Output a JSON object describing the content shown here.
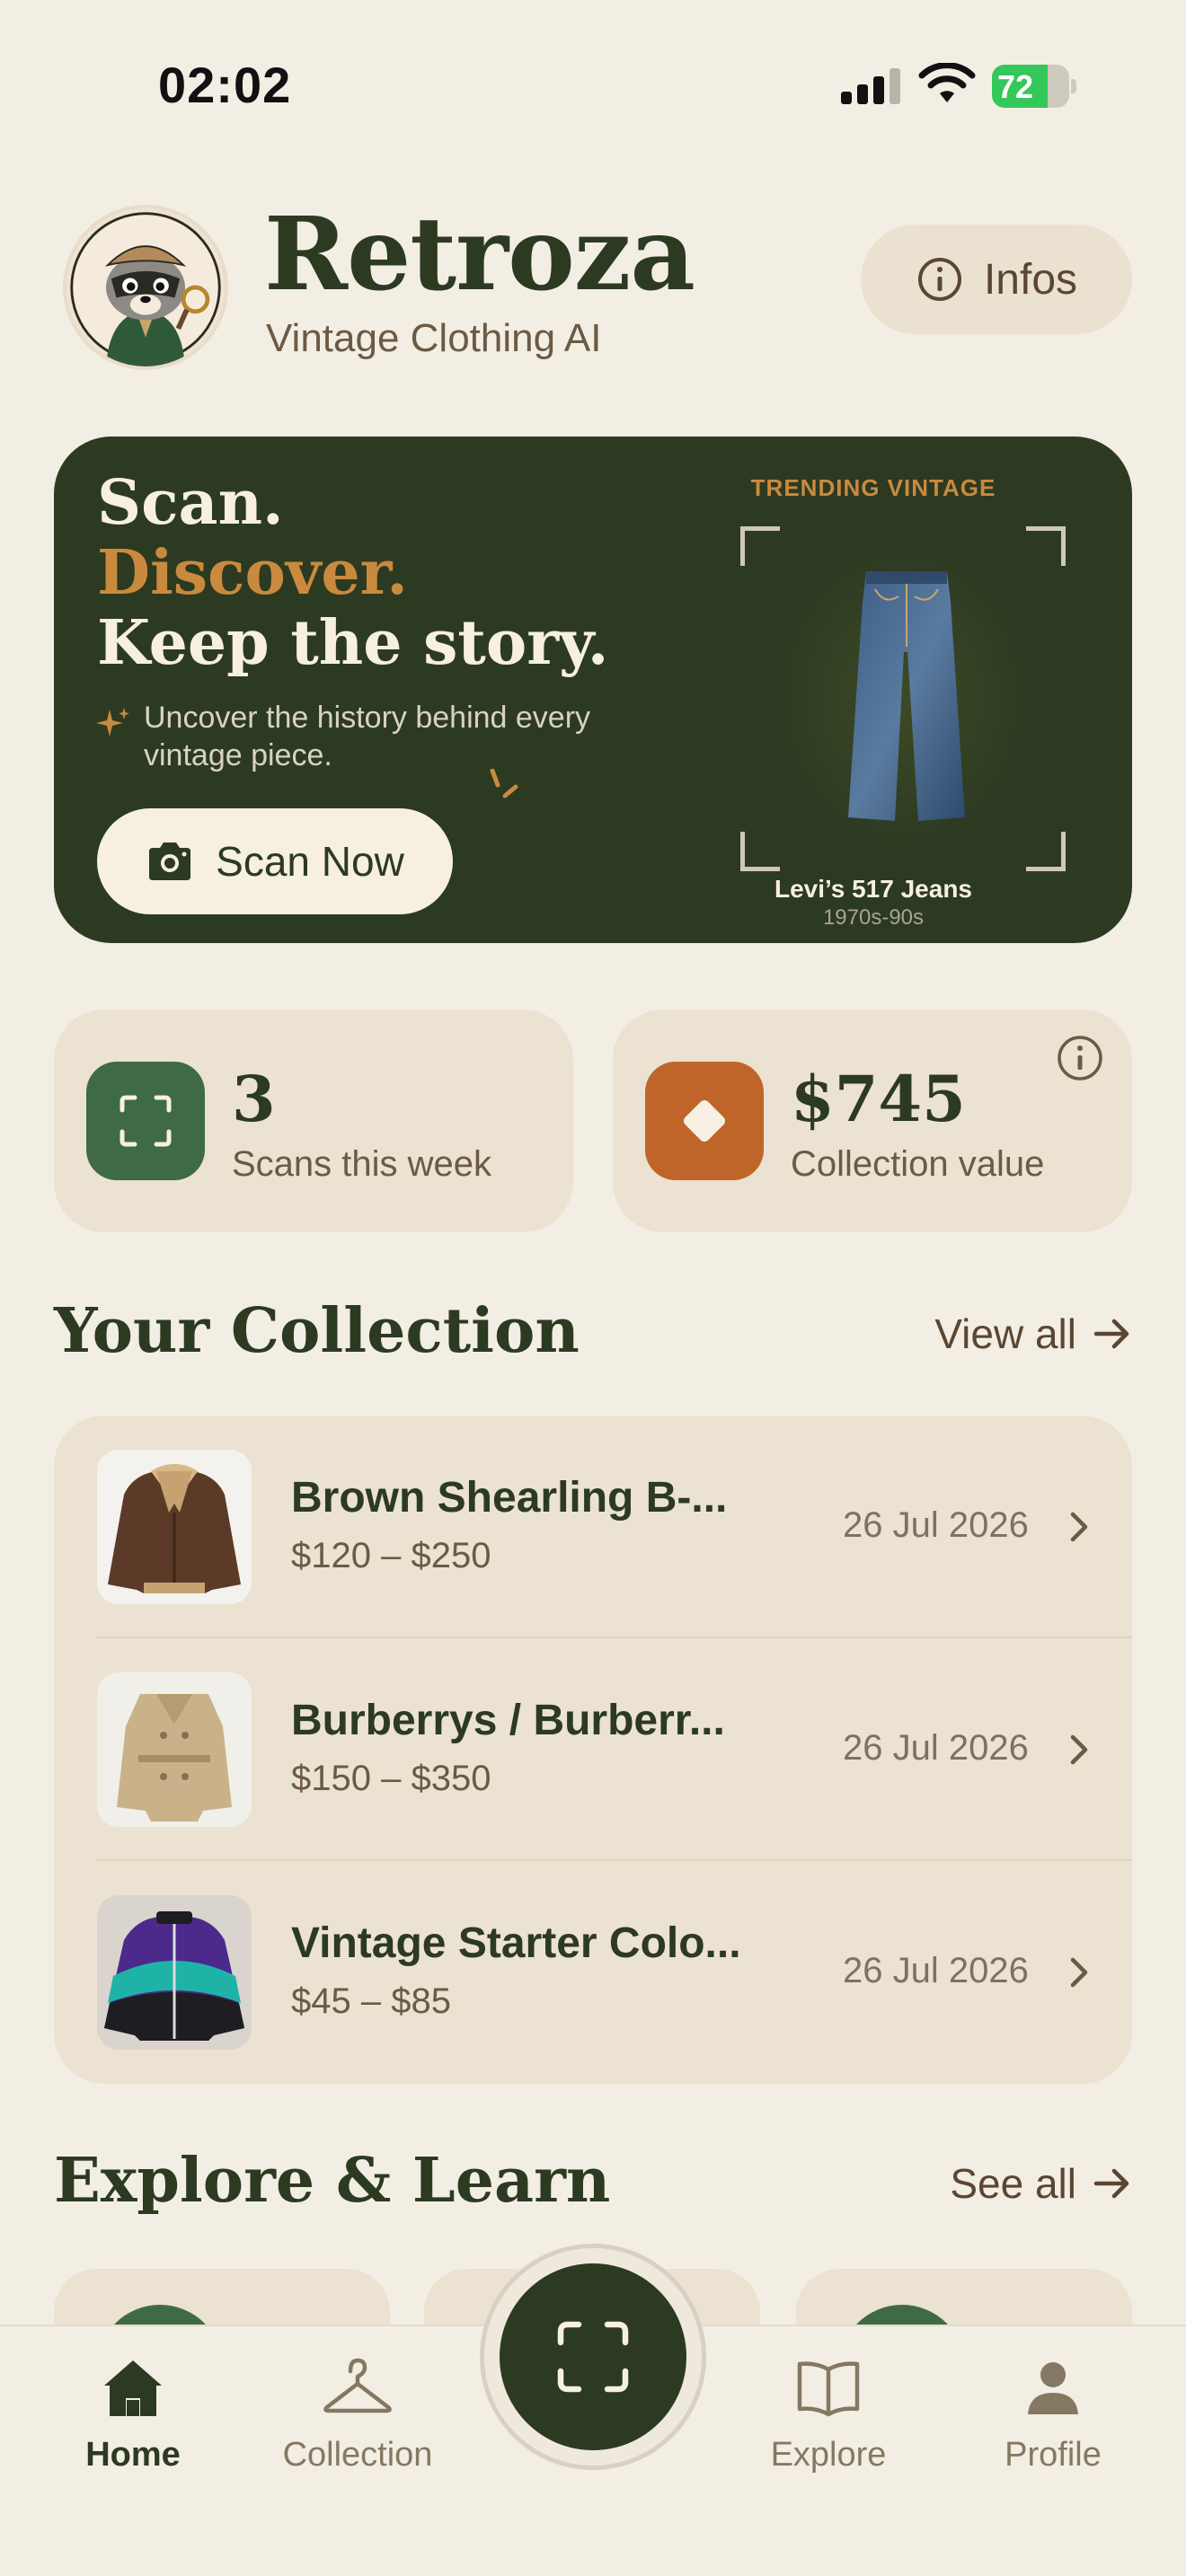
{
  "status_bar": {
    "time": "02:02",
    "battery": "72",
    "battery_level": 0.72
  },
  "header": {
    "title": "Retroza",
    "subtitle": "Vintage Clothing AI",
    "infos_label": "Infos"
  },
  "hero": {
    "line1": "Scan.",
    "line2": "Discover.",
    "line3": "Keep the story.",
    "description": "Uncover the history behind every vintage piece.",
    "scan_button": "Scan Now",
    "trending_label": "TRENDING VINTAGE",
    "trending_item": "Levi’s 517 Jeans",
    "trending_era": "1970s-90s"
  },
  "stats": [
    {
      "value": "3",
      "label": "Scans this week",
      "color": "#3e6b43"
    },
    {
      "value": "$745",
      "label": "Collection value",
      "color": "#c0652a"
    }
  ],
  "collection": {
    "title": "Your Collection",
    "view_all": "View all",
    "items": [
      {
        "name": "Brown Shearling B-...",
        "price": "$120 – $250",
        "date": "26 Jul 2026"
      },
      {
        "name": "Burberrys / Burberr...",
        "price": "$150 – $350",
        "date": "26 Jul 2026"
      },
      {
        "name": "Vintage Starter Colo...",
        "price": "$45 – $85",
        "date": "26 Jul 2026"
      }
    ]
  },
  "explore": {
    "title": "Explore & Learn",
    "see_all": "See all"
  },
  "tabs": {
    "home": "Home",
    "collection": "Collection",
    "explore": "Explore",
    "profile": "Profile"
  },
  "colors": {
    "primary": "#2c3a22",
    "accent": "#c98a3e",
    "background": "#f3eee4",
    "card": "#ebe2d2"
  },
  "icons": {
    "info": "info-circle-icon",
    "camera": "camera-icon",
    "scan": "scan-frame-icon",
    "diamond": "diamond-icon",
    "chevron": "chevron-right-icon",
    "arrow": "arrow-right-icon",
    "home": "home-icon",
    "hanger": "hanger-icon",
    "book": "book-icon",
    "profile": "person-icon"
  }
}
